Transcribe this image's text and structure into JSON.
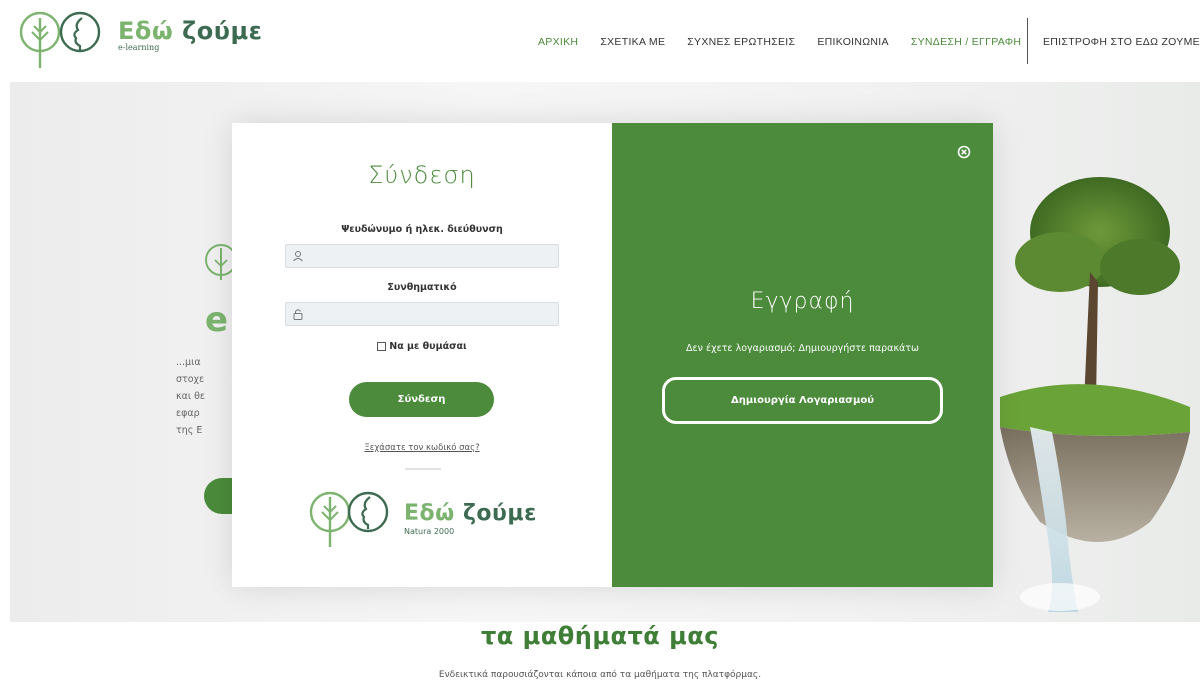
{
  "header": {
    "logo_title_part1": "Εδώ",
    "logo_title_part2": "ζούμε",
    "logo_sub": "e-learning",
    "nav": [
      "ΑΡΧΙΚΗ",
      "ΣΧΕΤΙΚΑ ΜΕ",
      "ΣΥΧΝΕΣ ΕΡΩΤΗΣΕΙΣ",
      "ΕΠΙΚΟΙΝΩΝΙΑ",
      "ΣΥΝΔΕΣΗ / ΕΓΓΡΑΦΗ"
    ],
    "nav_return": "ΕΠΙΣΤΡΟΦΗ ΣΤΟ ΕΔΩ ΖΟΥΜΕ",
    "active_color": "#4b8b3b"
  },
  "hero": {
    "letter": "e",
    "text_lines": [
      "...μια",
      "στοχε",
      "και θε",
      "εφαρ",
      "της Ε"
    ]
  },
  "login": {
    "title": "Σύνδεση",
    "username_label": "Ψευδώνυμο ή ηλεκ. διεύθυνση",
    "username_value": "",
    "password_label": "Συνθηματικό",
    "password_value": "",
    "remember_label": "Να με θυμάσαι",
    "remember_checked": false,
    "submit_label": "Σύνδεση",
    "forgot_label": "Ξεχάσατε τον κωδικό σας?",
    "brand_title_part1": "Εδώ",
    "brand_title_part2": "ζούμε",
    "brand_sub": "Natura 2000"
  },
  "register": {
    "title": "Εγγραφή",
    "subtitle": "Δεν έχετε λογαριασμό; Δημιουργήστε παρακάτω",
    "button_label": "Δημιουργία Λογαριασμού",
    "panel_color": "#4b8b3b"
  },
  "courses": {
    "title": "τα μαθήματά μας",
    "subtitle": "Ενδεικτικά παρουσιάζονται κάποια από τα μαθήματα της πλατφόρμας."
  },
  "icons": [
    "tree-logo-icon",
    "face-logo-icon",
    "user-icon",
    "lock-icon",
    "close-icon"
  ]
}
